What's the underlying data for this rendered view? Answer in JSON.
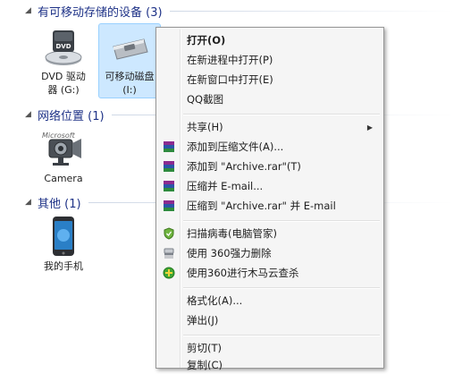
{
  "groups": {
    "removable": {
      "title": "有可移动存储的设备 (3)"
    },
    "network": {
      "title": "网络位置 (1)"
    },
    "other": {
      "title": "其他 (1)"
    }
  },
  "devices": {
    "dvd": {
      "line1": "DVD 驱动",
      "line2": "器 (G:)",
      "badge": "DVD"
    },
    "usb": {
      "line1": "可移动磁盘",
      "line2": "(I:)"
    },
    "camera": {
      "line1": "Camera",
      "watermark": "Microsoft"
    },
    "phone": {
      "line1": "我的手机"
    }
  },
  "context_menu": {
    "items": [
      {
        "label": "打开(O)"
      },
      {
        "label": "在新进程中打开(P)"
      },
      {
        "label": "在新窗口中打开(E)"
      },
      {
        "label": "QQ截图"
      },
      {
        "label": "共享(H)"
      },
      {
        "label": "添加到压缩文件(A)...",
        "icon": "winrar-icon"
      },
      {
        "label": "添加到 \"Archive.rar\"(T)",
        "icon": "winrar-icon"
      },
      {
        "label": "压缩并 E-mail...",
        "icon": "winrar-icon"
      },
      {
        "label": "压缩到 \"Archive.rar\" 并 E-mail",
        "icon": "winrar-icon"
      },
      {
        "label": "扫描病毒(电脑管家)",
        "icon": "shield-icon"
      },
      {
        "label": "使用 360强力删除",
        "icon": "shredder-icon"
      },
      {
        "label": "使用360进行木马云查杀",
        "icon": "360-icon"
      },
      {
        "label": "格式化(A)..."
      },
      {
        "label": "弹出(J)"
      },
      {
        "label": "剪切(T)"
      },
      {
        "label": "复制(C)"
      }
    ]
  },
  "colors": {
    "group_title": "#1e3287",
    "selection": "#cde8ff",
    "menu_bg": "#f5f5f5"
  }
}
